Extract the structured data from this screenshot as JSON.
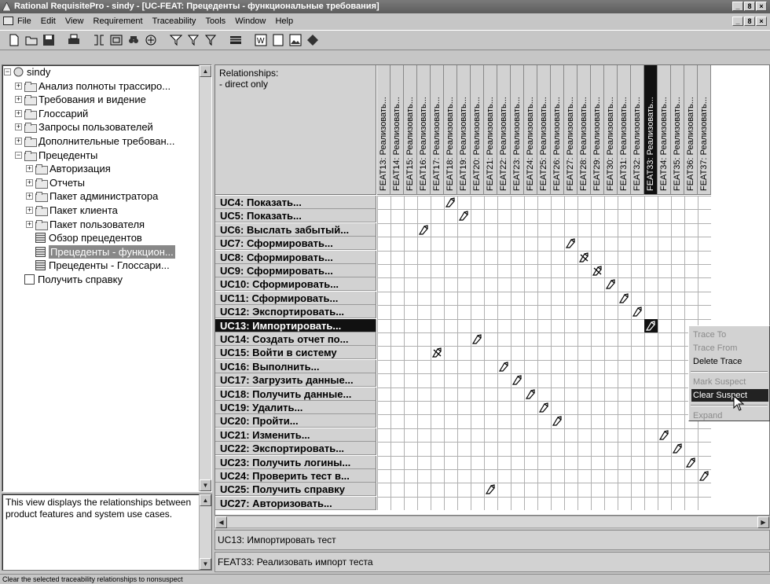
{
  "window": {
    "title": "Rational RequisitePro - sindy - [UC-FEAT: Прецеденты - функциональные требования]",
    "controls": [
      "_",
      "8",
      "×"
    ]
  },
  "menu": [
    "File",
    "Edit",
    "View",
    "Requirement",
    "Traceability",
    "Tools",
    "Window",
    "Help"
  ],
  "toolbar_icons": [
    "new-icon",
    "open-icon",
    "save-icon",
    "print-icon",
    "trace-from-icon",
    "trace-to-icon",
    "find-icon",
    "copy-icon",
    "filter-icon",
    "sort-icon",
    "query-icon",
    "matrix-view-icon",
    "word-icon",
    "doc-icon",
    "picture-icon",
    "diamond-icon"
  ],
  "tree": {
    "root": "sindy",
    "items": [
      {
        "label": "Анализ полноты трассиро...",
        "type": "folder",
        "exp": "+"
      },
      {
        "label": "Требования и видение",
        "type": "folder",
        "exp": "+"
      },
      {
        "label": "Глоссарий",
        "type": "folder",
        "exp": "+"
      },
      {
        "label": "Запросы пользователей",
        "type": "folder",
        "exp": "+"
      },
      {
        "label": "Дополнительные требован...",
        "type": "folder",
        "exp": "+"
      },
      {
        "label": "Прецеденты",
        "type": "folder",
        "exp": "-"
      },
      {
        "label": "Авторизация",
        "type": "folder",
        "exp": "+"
      },
      {
        "label": "Отчеты",
        "type": "folder",
        "exp": "+"
      },
      {
        "label": "Пакет администратора",
        "type": "folder",
        "exp": "+"
      },
      {
        "label": "Пакет клиента",
        "type": "folder",
        "exp": "+"
      },
      {
        "label": "Пакет пользователя",
        "type": "folder",
        "exp": "+"
      },
      {
        "label": "Обзор прецедентов",
        "type": "view"
      },
      {
        "label": "Прецеденты - функцион...",
        "type": "view",
        "selected": true
      },
      {
        "label": "Прецеденты - Глоссари...",
        "type": "view"
      },
      {
        "label": "Получить справку",
        "type": "doc"
      }
    ]
  },
  "description": "This view displays the relationships between product features and system use cases.",
  "matrix": {
    "corner_title": "Relationships:",
    "corner_sub": "- direct only",
    "columns": [
      "FEAT13: Реализовать...",
      "FEAT14: Реализовать...",
      "FEAT15: Реализовать...",
      "FEAT16: Реализовать...",
      "FEAT17: Реализовать...",
      "FEAT18: Реализовать...",
      "FEAT19: Реализовать...",
      "FEAT20: Реализовать...",
      "FEAT21: Реализовать...",
      "FEAT22: Реализовать...",
      "FEAT23: Реализовать...",
      "FEAT24: Реализовать...",
      "FEAT25: Реализовать...",
      "FEAT26: Реализовать...",
      "FEAT27: Реализовать...",
      "FEAT28: Реализовать...",
      "FEAT29: Реализовать...",
      "FEAT30: Реализовать...",
      "FEAT31: Реализовать...",
      "FEAT32: Реализовать...",
      "FEAT33: Реализовать...",
      "FEAT34: Реализовать...",
      "FEAT35: Реализовать...",
      "FEAT36: Реализовать...",
      "FEAT37: Реализовать..."
    ],
    "selected_column": 20,
    "rows": [
      "UC4: Показать...",
      "UC5: Показать...",
      "UC6: Выслать забытый...",
      "UC7: Сформировать...",
      "UC8: Сформировать...",
      "UC9: Сформировать...",
      "UC10: Сформировать...",
      "UC11: Сформировать...",
      "UC12: Экспортировать...",
      "UC13: Импортировать...",
      "UC14: Создать отчет по...",
      "UC15: Войти в систему",
      "UC16: Выполнить...",
      "UC17: Загрузить данные...",
      "UC18: Получить данные...",
      "UC19: Удалить...",
      "UC20: Пройти...",
      "UC21: Изменить...",
      "UC22: Экспортировать...",
      "UC23: Получить логины...",
      "UC24: Проверить тест в...",
      "UC25: Получить справку",
      "UC27: Авторизовать..."
    ],
    "selected_row": 9,
    "traces": [
      {
        "row": 0,
        "col": 5,
        "suspect": false
      },
      {
        "row": 1,
        "col": 6,
        "suspect": false
      },
      {
        "row": 2,
        "col": 3,
        "suspect": false
      },
      {
        "row": 3,
        "col": 14,
        "suspect": false
      },
      {
        "row": 4,
        "col": 15,
        "suspect": true
      },
      {
        "row": 5,
        "col": 16,
        "suspect": true
      },
      {
        "row": 6,
        "col": 17,
        "suspect": false
      },
      {
        "row": 7,
        "col": 18,
        "suspect": false
      },
      {
        "row": 8,
        "col": 19,
        "suspect": false
      },
      {
        "row": 9,
        "col": 20,
        "suspect": false
      },
      {
        "row": 10,
        "col": 7,
        "suspect": false
      },
      {
        "row": 11,
        "col": 4,
        "suspect": true
      },
      {
        "row": 12,
        "col": 9,
        "suspect": false
      },
      {
        "row": 13,
        "col": 10,
        "suspect": false
      },
      {
        "row": 14,
        "col": 11,
        "suspect": false
      },
      {
        "row": 15,
        "col": 12,
        "suspect": false
      },
      {
        "row": 16,
        "col": 13,
        "suspect": false
      },
      {
        "row": 17,
        "col": 21,
        "suspect": false
      },
      {
        "row": 18,
        "col": 22,
        "suspect": false
      },
      {
        "row": 19,
        "col": 23,
        "suspect": false
      },
      {
        "row": 20,
        "col": 24,
        "suspect": false
      },
      {
        "row": 21,
        "col": 8,
        "suspect": false
      }
    ]
  },
  "context_menu": [
    {
      "label": "Trace To",
      "disabled": true
    },
    {
      "label": "Trace From",
      "disabled": true
    },
    {
      "label": "Delete Trace",
      "disabled": false
    },
    {
      "sep": true
    },
    {
      "label": "Mark Suspect",
      "disabled": true
    },
    {
      "label": "Clear Suspect",
      "disabled": false,
      "highlighted": true
    },
    {
      "sep": true
    },
    {
      "label": "Expand",
      "disabled": true
    }
  ],
  "selected_row_text": "UC13: Импортировать тест",
  "selected_col_text": "FEAT33: Реализовать импорт теста",
  "status": "Clear the selected traceability relationships to nonsuspect"
}
